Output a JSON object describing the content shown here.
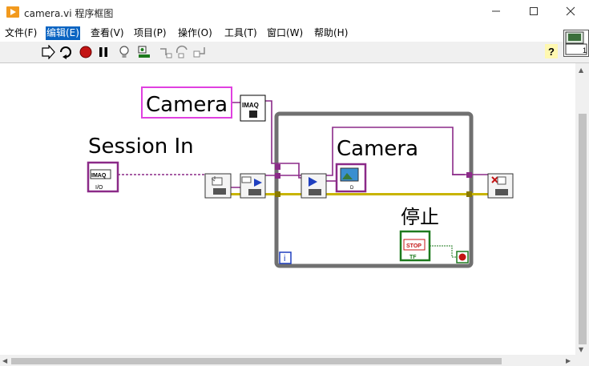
{
  "window": {
    "title": "camera.vi 程序框图",
    "minimize_icon": "minimize-icon",
    "maximize_icon": "maximize-icon",
    "close_icon": "close-icon"
  },
  "menu": {
    "items": [
      {
        "label": "文件(F)"
      },
      {
        "label": "编辑(E)",
        "active": true
      },
      {
        "label": "查看(V)"
      },
      {
        "label": "项目(P)"
      },
      {
        "label": "操作(O)"
      },
      {
        "label": "工具(T)"
      },
      {
        "label": "窗口(W)"
      },
      {
        "label": "帮助(H)"
      }
    ]
  },
  "toolbar": {
    "buttons": [
      "run-arrow-icon",
      "run-continuously-icon",
      "abort-icon",
      "pause-icon",
      "highlight-execution-icon",
      "retain-wire-values-icon",
      "step-into-icon",
      "step-over-icon",
      "step-out-icon"
    ],
    "help_icon": "context-help-icon",
    "connector_number": "1"
  },
  "diagram": {
    "labels": {
      "camera_control": "Camera",
      "session_in": "Session In",
      "camera_indicator": "Camera",
      "stop": "停止"
    },
    "imaq_constant": "IMAQ",
    "session_io": "IMAQ",
    "io_sub": "I/O",
    "stop_text": "STOP",
    "tf_text": "TF",
    "loop_iteration": "i",
    "image_display_text": "D"
  },
  "colors": {
    "accent": "#0a64c2",
    "image_wire": "#8b2a88",
    "error_wire": "#c8b400",
    "while_loop": "#6d6d6d",
    "control_border": "#e040e0",
    "boolean_green": "#1e7a1e"
  }
}
